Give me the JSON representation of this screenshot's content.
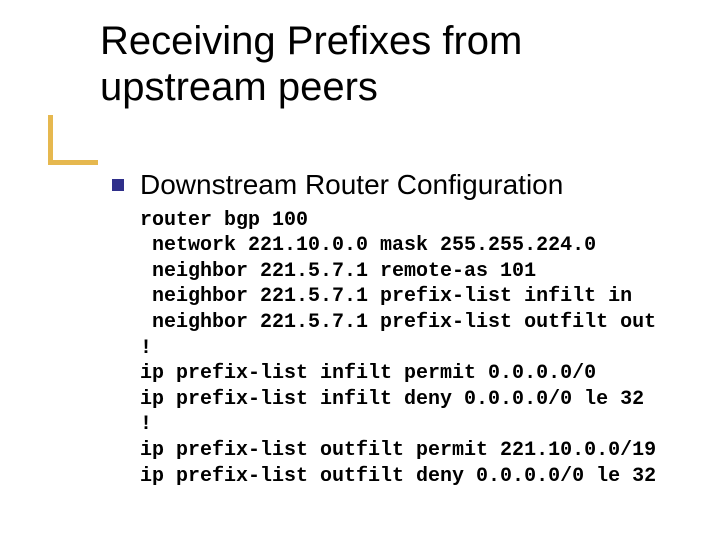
{
  "title": "Receiving Prefixes from upstream peers",
  "bullet": "Downstream Router Configuration",
  "code": "router bgp 100\n network 221.10.0.0 mask 255.255.224.0\n neighbor 221.5.7.1 remote-as 101\n neighbor 221.5.7.1 prefix-list infilt in\n neighbor 221.5.7.1 prefix-list outfilt out\n!\nip prefix-list infilt permit 0.0.0.0/0\nip prefix-list infilt deny 0.0.0.0/0 le 32\n!\nip prefix-list outfilt permit 221.10.0.0/19\nip prefix-list outfilt deny 0.0.0.0/0 le 32"
}
